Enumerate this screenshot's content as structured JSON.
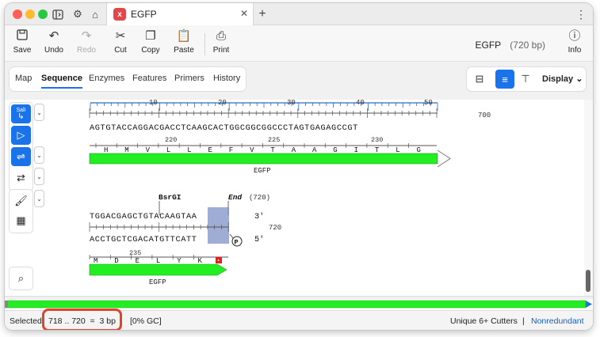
{
  "tab": {
    "title": "EGFP",
    "logo": "x"
  },
  "toolbar": {
    "save": "Save",
    "undo": "Undo",
    "redo": "Redo",
    "cut": "Cut",
    "copy": "Copy",
    "paste": "Paste",
    "print": "Print",
    "info": "Info"
  },
  "sequence_info": {
    "name": "EGFP",
    "length": "(720 bp)"
  },
  "view_tabs": [
    "Map",
    "Sequence",
    "Enzymes",
    "Features",
    "Primers",
    "History"
  ],
  "active_tab": "Sequence",
  "display_label": "Display",
  "sidebar": {
    "enzyme_button_label": "SalI"
  },
  "ruler": {
    "ticks": [
      "10",
      "20",
      "30",
      "40",
      "50"
    ],
    "row_end": "700"
  },
  "row1": {
    "dna": "AGTGTACCAGGACGACCTCAAGCACTGGCGGCGGCCCTAGTGAGAGCCGT",
    "aa_numbers": [
      "220",
      "225",
      "230"
    ],
    "aa": [
      "H",
      "M",
      "V",
      "L",
      "L",
      "E",
      "F",
      "V",
      "T",
      "A",
      "A",
      "G",
      "I",
      "T",
      "L",
      "G"
    ],
    "feature": "EGFP"
  },
  "row2": {
    "enzyme": "BsrGI",
    "end_label": "End",
    "end_pos": "(720)",
    "top": "TGGACGAGCTGTACAAGTAA",
    "top_suffix": "3'",
    "bottom": "ACCTGCTCGACATGTTCATT",
    "bottom_suffix": "5'",
    "pos": "720",
    "primer_badge": "P",
    "aa_number": "235",
    "aa": [
      "M",
      "D",
      "E",
      "L",
      "Y",
      "K"
    ],
    "stop": "•",
    "feature": "EGFP"
  },
  "status": {
    "selected_label": "Selected:",
    "selection": "718 .. 720  =  3 bp",
    "gc": "[0% GC]",
    "cutters": "Unique 6+ Cutters",
    "separator": "|",
    "nonredundant": "Nonredundant"
  },
  "colors": {
    "accent": "#1a73e8",
    "feature": "#22ee22",
    "highlight": "#e2412a",
    "selection": "#7f92c6"
  }
}
